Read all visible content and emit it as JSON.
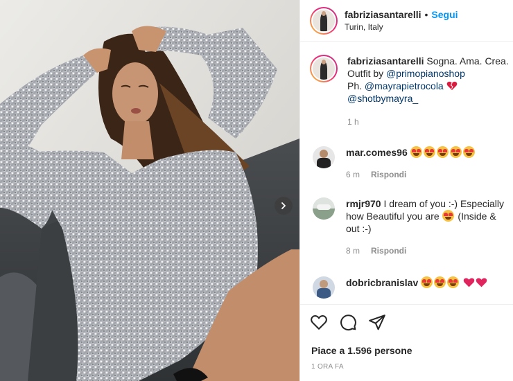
{
  "header": {
    "username": "fabriziasantarelli",
    "separator": "•",
    "follow_label": "Segui",
    "location": "Turin, Italy"
  },
  "caption": {
    "username": "fabriziasantarelli",
    "text_1": "Sogna. Ama. Crea. Outfit by ",
    "mention_1": "@primopianoshop",
    "text_2": "Ph. ",
    "mention_2": "@mayrapietrocola",
    "mention_3": "@shotbymayra_",
    "time": "1 h"
  },
  "comments": [
    {
      "username": "mar.comes96",
      "text": "",
      "emojis": [
        "heart-eyes-emoji",
        "heart-eyes-emoji",
        "heart-eyes-emoji",
        "heart-eyes-emoji",
        "heart-eyes-emoji"
      ],
      "time": "6 m",
      "reply_label": "Rispondi"
    },
    {
      "username": "rmjr970",
      "text": "I dream of you :-) Especially how Beautiful you are ",
      "text_after": " (Inside & out :-)",
      "time": "8 m",
      "reply_label": "Rispondi"
    },
    {
      "username": "dobricbranislav",
      "emojis": [
        "heart-eyes-emoji",
        "heart-eyes-emoji",
        "heart-eyes-emoji",
        "red-heart-emoji",
        "red-heart-emoji"
      ]
    }
  ],
  "actions": {
    "like_icon": "heart-outline-icon",
    "comment_icon": "speech-bubble-icon",
    "share_icon": "paper-plane-icon",
    "likes_text": "Piace a 1.596 persone",
    "timestamp": "1 ORA FA"
  },
  "carousel": {
    "next_icon": "chevron-right-icon"
  },
  "colors": {
    "accent": "#0095f6",
    "mention": "#00376b",
    "muted": "#8e8e8e",
    "heart": "#e0245e"
  }
}
